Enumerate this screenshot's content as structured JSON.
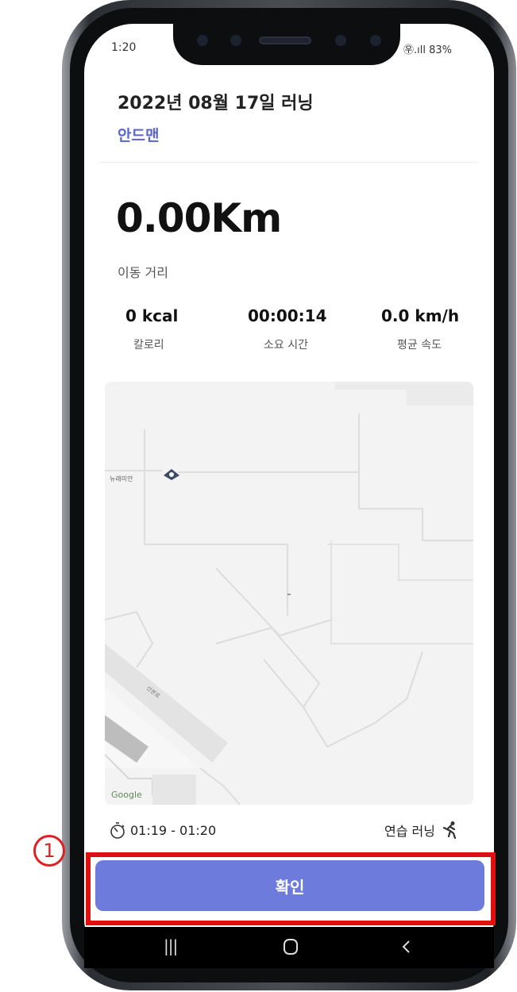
{
  "status_bar": {
    "time": "1:20",
    "right": "㉾.ıll 83%"
  },
  "header": {
    "title": "2022년 08월 17일 러닝",
    "user": "안드맨"
  },
  "distance": {
    "value": "0.00Km",
    "label": "이동 거리"
  },
  "stats": [
    {
      "value": "0 kcal",
      "label": "칼로리"
    },
    {
      "value": "00:00:14",
      "label": "소요 시간"
    },
    {
      "value": "0.0 km/h",
      "label": "평균 속도"
    }
  ],
  "map": {
    "poi_label": "뉴래미안",
    "google_label": "Google"
  },
  "footer": {
    "time_range": "01:19 - 01:20",
    "mode": "연습 러닝"
  },
  "badge": "1",
  "confirm_button": "확인",
  "icons": {
    "timer": "stopwatch-icon",
    "runner": "runner-icon",
    "nav_recents": "recents-icon",
    "nav_home": "home-icon",
    "nav_back": "back-icon"
  }
}
